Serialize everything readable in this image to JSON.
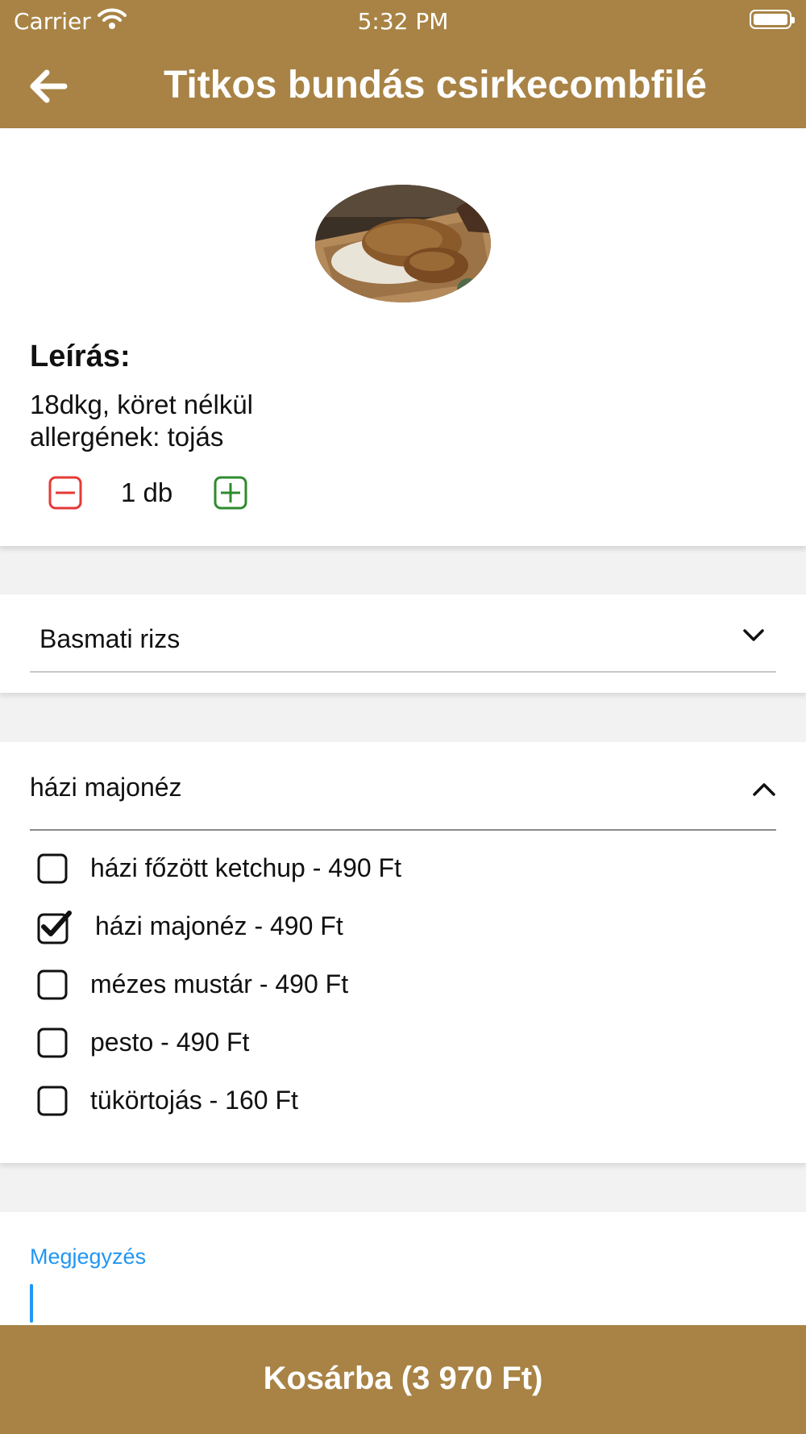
{
  "status_bar": {
    "carrier": "Carrier",
    "time": "5:32 PM"
  },
  "header": {
    "title": "Titkos bundás csirkecombfilé"
  },
  "product": {
    "description_heading": "Leírás:",
    "description_lines": [
      "18dkg, köret nélkül",
      "allergének: tojás"
    ],
    "quantity_label": "1 db"
  },
  "side_select": {
    "value": "Basmati rizs"
  },
  "sauce": {
    "selected": "házi majonéz",
    "options": [
      {
        "label": "házi főzött ketchup - 490 Ft",
        "checked": false
      },
      {
        "label": "házi majonéz - 490 Ft",
        "checked": true
      },
      {
        "label": "mézes mustár - 490 Ft",
        "checked": false
      },
      {
        "label": "pesto - 490 Ft",
        "checked": false
      },
      {
        "label": "tükörtojás - 160 Ft",
        "checked": false
      }
    ]
  },
  "note": {
    "label": "Megjegyzés",
    "value": ""
  },
  "cart_button": {
    "label": "Kosárba (3 970 Ft)"
  },
  "colors": {
    "brand": "#a88345",
    "minus": "#e53935",
    "plus": "#2e8b2e",
    "accent": "#2196f3"
  }
}
